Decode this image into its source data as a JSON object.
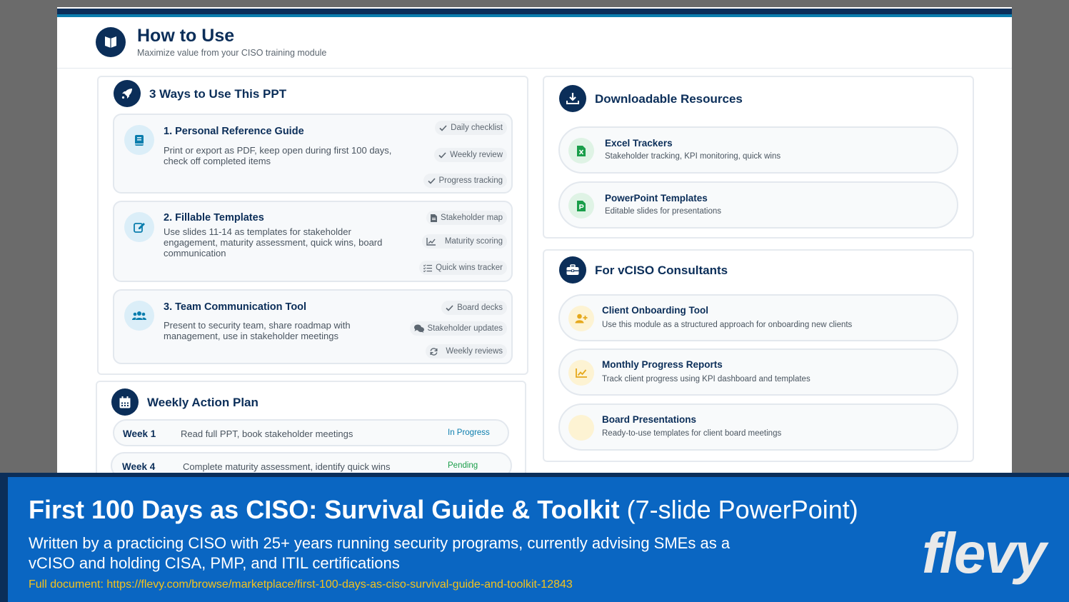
{
  "header": {
    "title": "How to Use",
    "subtitle": "Maximize value from your CISO training module"
  },
  "ways": {
    "title": "3 Ways to Use This PPT",
    "cards": [
      {
        "title": "1. Personal Reference Guide",
        "desc": "Print or export as PDF, keep open during first 100 days, check off completed items",
        "tags": [
          "Daily checklist",
          "Weekly review",
          "Progress tracking"
        ]
      },
      {
        "title": "2. Fillable Templates",
        "desc": "Use slides 11-14 as templates for stakeholder engagement, maturity assessment, quick wins, board communication",
        "tags": [
          "Stakeholder map",
          "Maturity scoring",
          "Quick wins tracker"
        ]
      },
      {
        "title": "3. Team Communication Tool",
        "desc": "Present to security team, share roadmap with management, use in stakeholder meetings",
        "tags": [
          "Board decks",
          "Stakeholder updates",
          "Weekly reviews"
        ]
      }
    ]
  },
  "weekly": {
    "title": "Weekly Action Plan",
    "rows": [
      {
        "week": "Week 1",
        "text": "Read full PPT, book stakeholder meetings",
        "status": "In Progress",
        "status_color": "#0a7dad"
      },
      {
        "week": "Week 4",
        "text": "Complete maturity assessment, identify quick wins",
        "status": "Pending",
        "status_color": "#1a9e4a"
      }
    ]
  },
  "downloads": {
    "title": "Downloadable Resources",
    "items": [
      {
        "title": "Excel Trackers",
        "desc": "Stakeholder tracking, KPI monitoring, quick wins",
        "icon": "excel-file-icon"
      },
      {
        "title": "PowerPoint Templates",
        "desc": "Editable slides for presentations",
        "icon": "powerpoint-file-icon"
      }
    ]
  },
  "vciso": {
    "title": "For vCISO Consultants",
    "items": [
      {
        "title": "Client Onboarding Tool",
        "desc": "Use this module as a structured approach for onboarding new clients",
        "icon": "user-plus-icon"
      },
      {
        "title": "Monthly Progress Reports",
        "desc": "Track client progress using KPI dashboard and templates",
        "icon": "chart-line-icon"
      },
      {
        "title": "Board Presentations",
        "desc": "Ready-to-use templates for client board meetings",
        "icon": "presentation-icon"
      }
    ]
  },
  "footer": {
    "title_bold": "First 100 Days as CISO: Survival Guide & Toolkit",
    "title_light": "(7-slide PowerPoint)",
    "desc": "Written by a practicing CISO with 25+ years running security programs, currently advising SMEs as a vCISO and holding CISA, PMP, and ITIL certifications",
    "link": "Full document: https://flevy.com/browse/marketplace/first-100-days-as-ciso-survival-guide-and-toolkit-12843",
    "logo": "flevy"
  },
  "colors": {
    "navy": "#0b2e59",
    "teal": "#0a7dad",
    "footer_blue": "#0a66c2",
    "link_yellow": "#f5c21b"
  }
}
